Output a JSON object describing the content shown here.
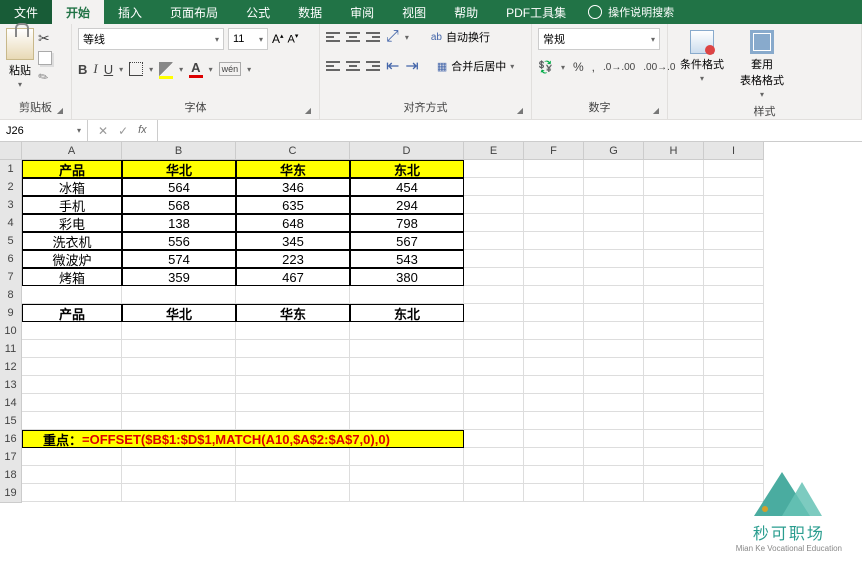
{
  "tabs": {
    "file": "文件",
    "home": "开始",
    "insert": "插入",
    "layout": "页面布局",
    "formula": "公式",
    "data": "数据",
    "review": "审阅",
    "view": "视图",
    "help": "帮助",
    "pdf": "PDF工具集",
    "search": "操作说明搜索"
  },
  "ribbon": {
    "clipboard": {
      "paste": "粘贴",
      "label": "剪贴板"
    },
    "font": {
      "name": "等线",
      "size": "11",
      "label": "字体",
      "B": "B",
      "I": "I",
      "U": "U",
      "A": "A",
      "wen": "wén"
    },
    "align": {
      "wrap": "自动换行",
      "merge": "合并后居中",
      "label": "对齐方式",
      "ab": "ab"
    },
    "number": {
      "format": "常规",
      "label": "数字"
    },
    "styles": {
      "cond": "条件格式",
      "table": "套用\n表格格式",
      "label": "样式"
    }
  },
  "namebox": "J26",
  "fx": "fx",
  "cols": [
    "A",
    "B",
    "C",
    "D",
    "E",
    "F",
    "G",
    "H",
    "I"
  ],
  "chart_data": {
    "type": "table",
    "headers": [
      "产品",
      "华北",
      "华东",
      "东北"
    ],
    "rows": [
      [
        "冰箱",
        564,
        346,
        454
      ],
      [
        "手机",
        568,
        635,
        294
      ],
      [
        "彩电",
        138,
        648,
        798
      ],
      [
        "洗衣机",
        556,
        345,
        567
      ],
      [
        "微波炉",
        574,
        223,
        543
      ],
      [
        "烤箱",
        359,
        467,
        380
      ]
    ],
    "headers2": [
      "产品",
      "华北",
      "华东",
      "东北"
    ]
  },
  "formula": {
    "label": "重点：",
    "text": "=OFFSET($B$1:$D$1,MATCH(A10,$A$2:$A$7,0),0)"
  },
  "watermark": {
    "cn": "秒可职场",
    "en": "Mian Ke Vocational Education"
  }
}
